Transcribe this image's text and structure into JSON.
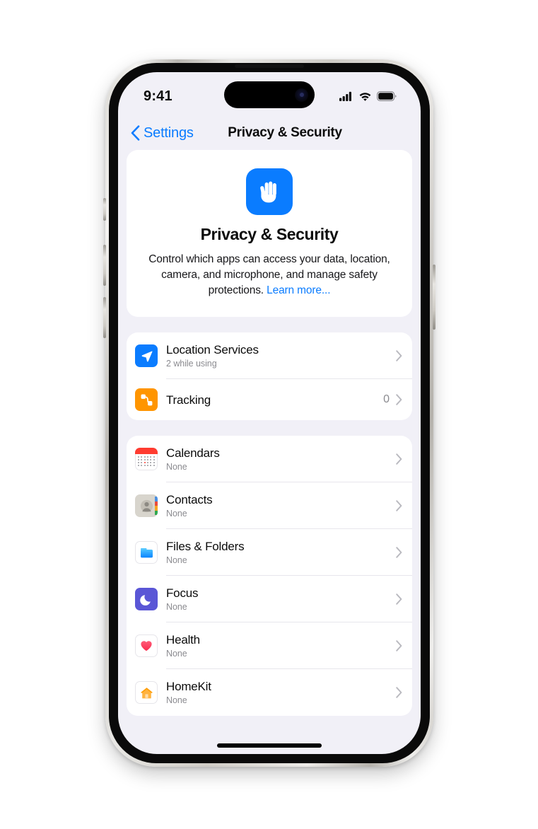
{
  "status_bar": {
    "time": "9:41",
    "signal_icon": "cellular-signal-icon",
    "wifi_icon": "wifi-icon",
    "battery_icon": "battery-icon"
  },
  "nav": {
    "back_label": "Settings",
    "back_icon": "chevron-left-icon",
    "title": "Privacy & Security"
  },
  "hero": {
    "icon": "hand-raised-icon",
    "icon_color": "#0a7cff",
    "title": "Privacy & Security",
    "description": "Control which apps can access your data, location, camera, and microphone, and manage safety protections. ",
    "link_label": "Learn more...",
    "link_color": "#0a7cff"
  },
  "groups": [
    {
      "rows": [
        {
          "title": "Location Services",
          "subtitle": "2 while using",
          "value": "",
          "icon": "location-arrow-icon",
          "icon_color": "#0a7cff"
        },
        {
          "title": "Tracking",
          "subtitle": "",
          "value": "0",
          "icon": "tracking-icon",
          "icon_color": "#ff9500"
        }
      ]
    },
    {
      "rows": [
        {
          "title": "Calendars",
          "subtitle": "None",
          "value": "",
          "icon": "calendar-icon",
          "icon_color": "#ff3b30"
        },
        {
          "title": "Contacts",
          "subtitle": "None",
          "value": "",
          "icon": "contacts-icon",
          "icon_color": "#d8d5cd"
        },
        {
          "title": "Files & Folders",
          "subtitle": "None",
          "value": "",
          "icon": "folder-icon",
          "icon_color": "#1aa3ff"
        },
        {
          "title": "Focus",
          "subtitle": "None",
          "value": "",
          "icon": "moon-icon",
          "icon_color": "#5a56d6"
        },
        {
          "title": "Health",
          "subtitle": "None",
          "value": "",
          "icon": "heart-icon",
          "icon_color": "#fc3158"
        },
        {
          "title": "HomeKit",
          "subtitle": "None",
          "value": "",
          "icon": "house-icon",
          "icon_color": "#ff9f0a"
        }
      ]
    }
  ],
  "colors": {
    "screen_background": "#f1f0f7",
    "card_background": "#ffffff",
    "accent": "#0a7cff",
    "secondary_text": "#8b8b90",
    "separator": "#e7e6ec"
  }
}
